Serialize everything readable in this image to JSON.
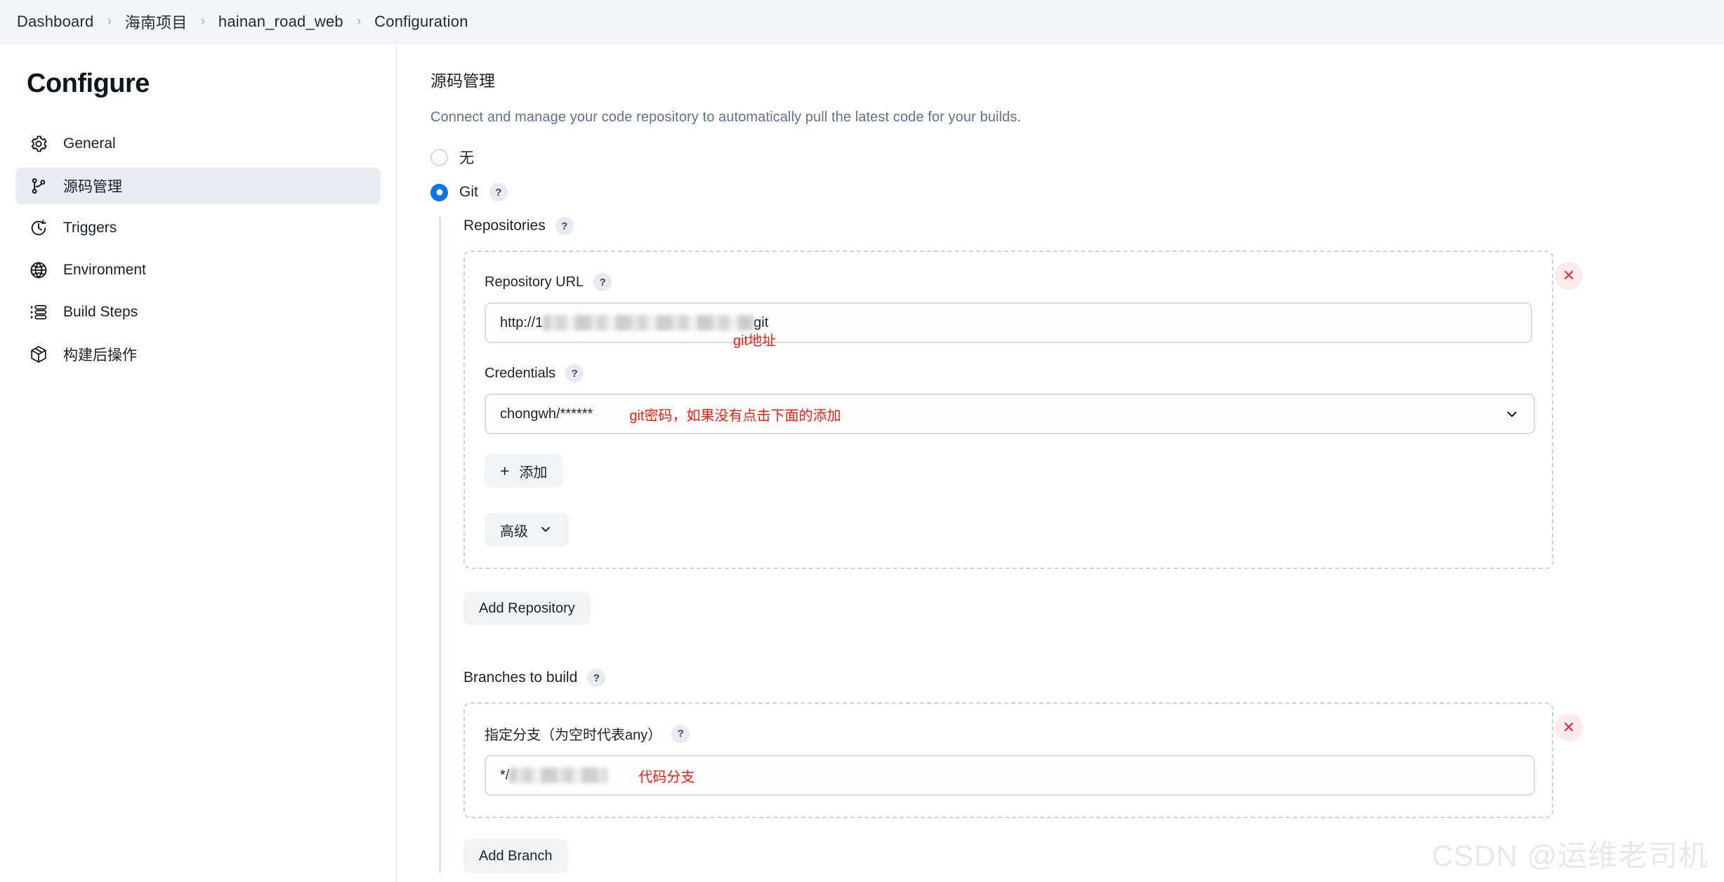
{
  "breadcrumb": {
    "items": [
      "Dashboard",
      "海南项目",
      "hainan_road_web",
      "Configuration"
    ],
    "separator": "›"
  },
  "sidebar": {
    "title": "Configure",
    "items": [
      {
        "label": "General",
        "icon": "gear-icon",
        "active": false
      },
      {
        "label": "源码管理",
        "icon": "source-branch-icon",
        "active": true
      },
      {
        "label": "Triggers",
        "icon": "clock-icon",
        "active": false
      },
      {
        "label": "Environment",
        "icon": "globe-icon",
        "active": false
      },
      {
        "label": "Build Steps",
        "icon": "list-steps-icon",
        "active": false
      },
      {
        "label": "构建后操作",
        "icon": "package-icon",
        "active": false
      }
    ]
  },
  "main": {
    "section_title": "源码管理",
    "section_desc": "Connect and manage your code repository to automatically pull the latest code for your builds.",
    "help_glyph": "?",
    "scm_options": [
      {
        "label": "无",
        "selected": false,
        "has_help": false
      },
      {
        "label": "Git",
        "selected": true,
        "has_help": true
      }
    ],
    "repositories_label": "Repositories",
    "repository": {
      "url_label": "Repository URL",
      "url_prefix": "http://1",
      "url_suffix": "git",
      "url_annotation": "git地址",
      "credentials_label": "Credentials",
      "credentials_value": "chongwh/******",
      "credentials_annotation": "git密码，如果没有点击下面的添加",
      "add_credential_label": "添加",
      "add_credential_plus": "+",
      "advanced_label": "高级",
      "close_glyph": "✕"
    },
    "add_repository_label": "Add Repository",
    "branches_label": "Branches to build",
    "branch": {
      "spec_label": "指定分支（为空时代表any）",
      "value_prefix": "*/",
      "annotation": "代码分支",
      "close_glyph": "✕"
    },
    "add_branch_label": "Add Branch"
  },
  "watermark": "CSDN @运维老司机",
  "colors": {
    "accent": "#0b72e7",
    "annotation_red": "#fa1a0e",
    "desc_blue": "#5f7292",
    "active_nav_bg": "#e9ecf1",
    "close_bg": "#fdebec",
    "close_fg": "#e02c43"
  }
}
